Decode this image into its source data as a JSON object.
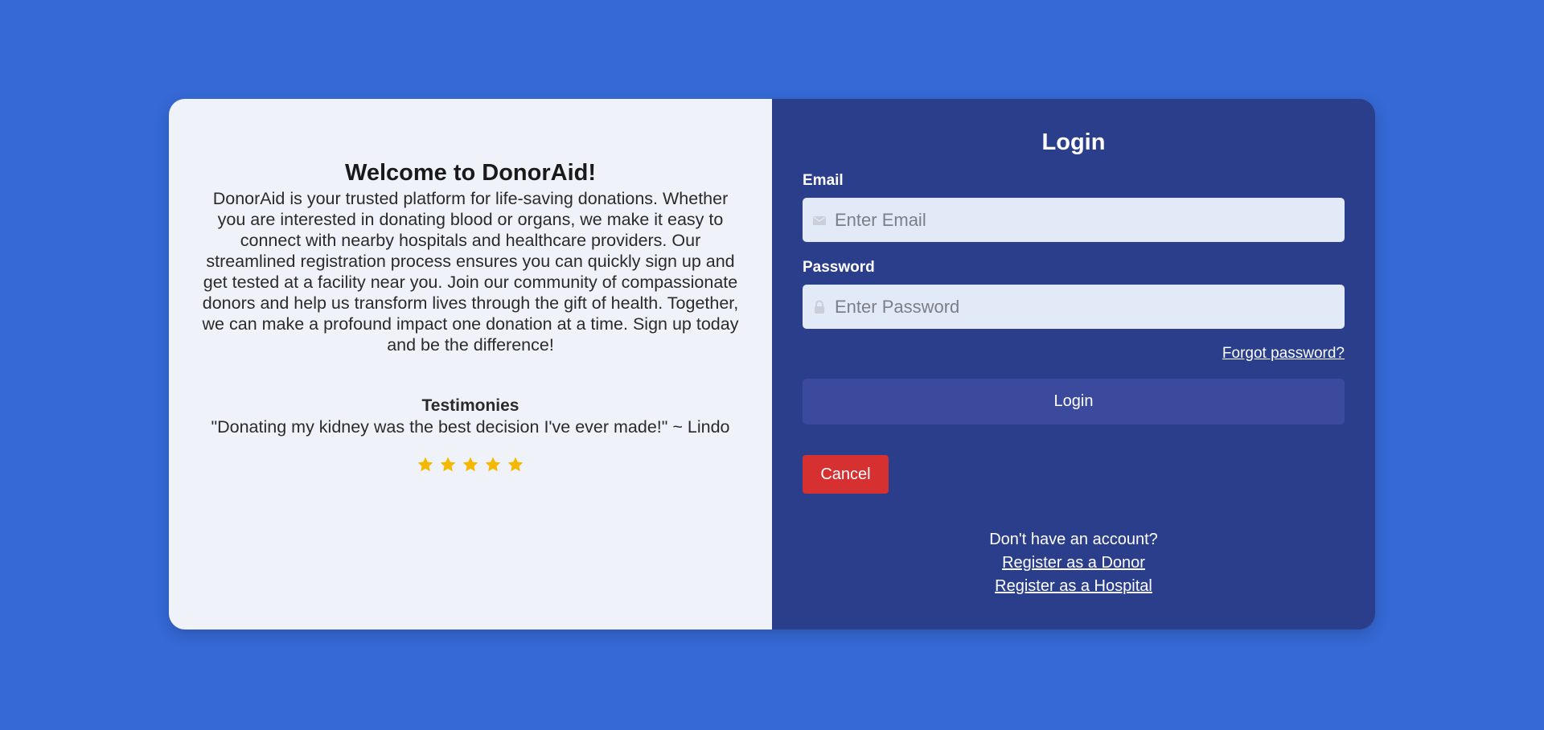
{
  "welcome": {
    "title": "Welcome to DonorAid!",
    "text": "DonorAid is your trusted platform for life-saving donations. Whether you are interested in donating blood or organs, we make it easy to connect with nearby hospitals and healthcare providers. Our streamlined registration process ensures you can quickly sign up and get tested at a facility near you. Join our community of compassionate donors and help us transform lives through the gift of health. Together, we can make a profound impact one donation at a time. Sign up today and be the difference!"
  },
  "testimonies": {
    "title": "Testimonies",
    "quote": "\"Donating my kidney was the best decision I've ever made!\" ~ Lindo",
    "rating": 5,
    "rating_max": 5,
    "star_color": "#f5b800"
  },
  "login": {
    "title": "Login",
    "email_label": "Email",
    "email_placeholder": "Enter Email",
    "email_icon": "envelope-icon",
    "password_label": "Password",
    "password_placeholder": "Enter Password",
    "password_icon": "lock-icon",
    "forgot_label": "Forgot password?",
    "login_button": "Login",
    "cancel_button": "Cancel"
  },
  "register": {
    "prompt": "Don't have an account?",
    "donor_link": "Register as a Donor",
    "hospital_link": "Register as a Hospital"
  },
  "colors": {
    "background": "#3669d6",
    "left_panel": "#eff3f9",
    "right_panel": "#2b3e8c",
    "login_button": "#3c4a9e",
    "cancel_button": "#d63030",
    "input_bg": "#e2e9f7"
  }
}
